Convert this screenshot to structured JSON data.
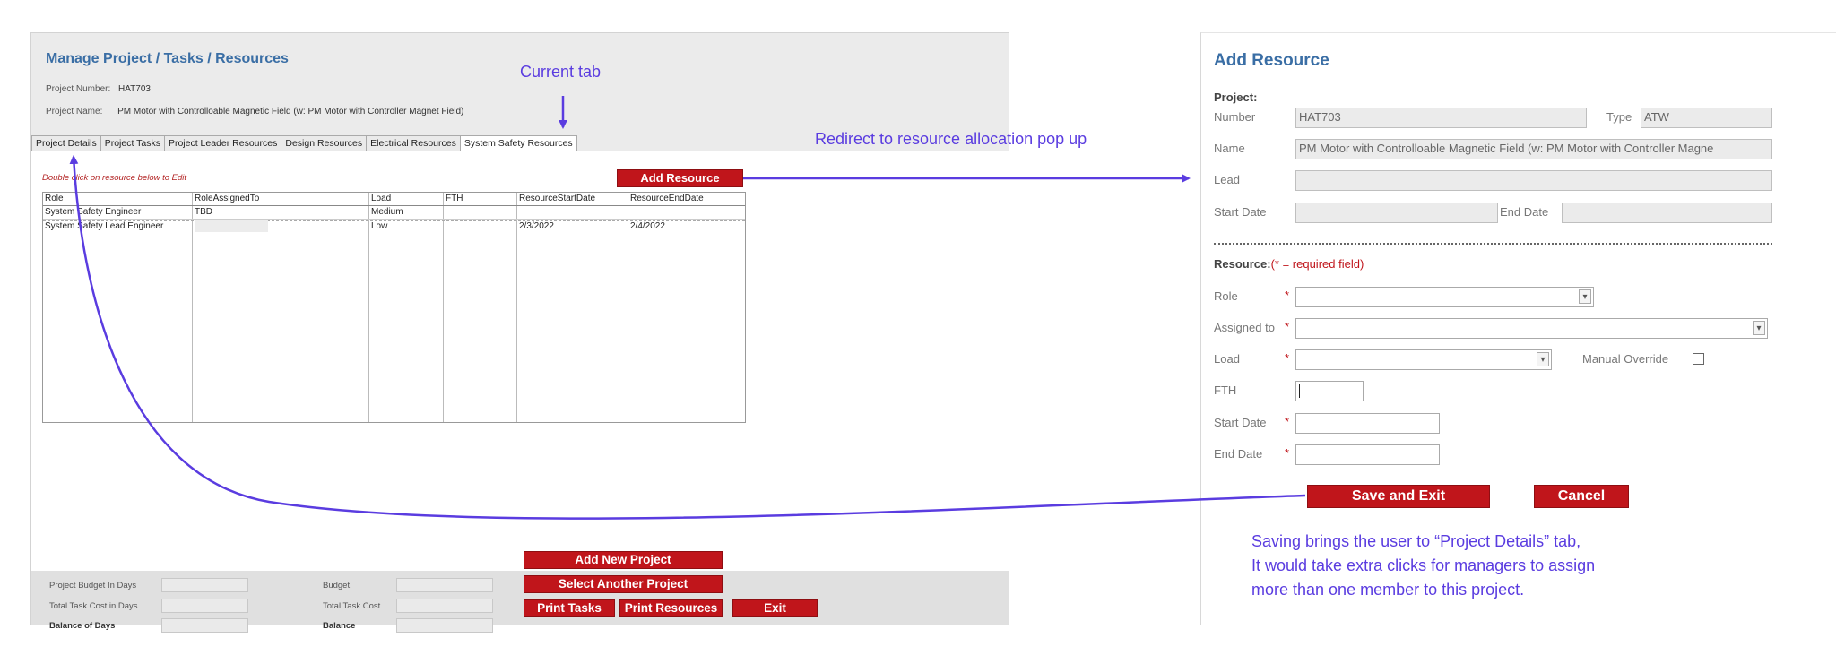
{
  "left": {
    "title": "Manage Project / Tasks / Resources",
    "project_number_label": "Project Number:",
    "project_number_value": "HAT703",
    "project_name_label": "Project Name:",
    "project_name_value": "PM Motor with Controlloable Magnetic Field (w: PM Motor with Controller Magnet Field)",
    "tabs": [
      "Project Details",
      "Project Tasks",
      "Project Leader Resources",
      "Design Resources",
      "Electrical Resources",
      "System Safety Resources"
    ],
    "active_tab": "System Safety Resources",
    "hint": "Double click on resource below to Edit",
    "add_resource_label": "Add Resource",
    "table": {
      "headers": [
        "Role",
        "RoleAssignedTo",
        "Load",
        "FTH",
        "ResourceStartDate",
        "ResourceEndDate"
      ],
      "rows": [
        [
          "System Safety Engineer",
          "TBD",
          "Medium",
          "",
          "",
          ""
        ],
        [
          "System Safety Lead Engineer",
          "",
          "Low",
          "",
          "2/3/2022",
          "2/4/2022"
        ]
      ]
    },
    "bottom": {
      "budget_days_label": "Project Budget In Days",
      "task_cost_days_label": "Total Task Cost in Days",
      "balance_days_label": "Balance of Days",
      "budget_label": "Budget",
      "task_cost_label": "Total Task Cost",
      "balance_label": "Balance",
      "add_new_project": "Add New Project",
      "select_another_project": "Select Another Project",
      "print_tasks": "Print Tasks",
      "print_resources": "Print  Resources",
      "exit": "Exit"
    }
  },
  "right": {
    "title": "Add Resource",
    "project_section": "Project:",
    "number_label": "Number",
    "number_value": "HAT703",
    "type_label": "Type",
    "type_value": "ATW",
    "name_label": "Name",
    "name_value": "PM Motor with Controlloable Magnetic Field (w: PM Motor with Controller Magne",
    "lead_label": "Lead",
    "start_date_label": "Start Date",
    "end_date_label": "End Date",
    "resource_section": "Resource:",
    "required_note": "(* = required field)",
    "role_label": "Role",
    "assigned_to_label": "Assigned to",
    "load_label": "Load",
    "manual_override_label": "Manual Override",
    "fth_label": "FTH",
    "r_start_date_label": "Start Date",
    "r_end_date_label": "End Date",
    "req_mark": "*",
    "save_exit": "Save and Exit",
    "cancel": "Cancel"
  },
  "annotations": {
    "current_tab": "Current tab",
    "redirect": "Redirect to resource allocation pop up",
    "saving_line1": "Saving brings the user to “Project Details” tab,",
    "saving_line2": "It would take extra clicks for managers to assign",
    "saving_line3": "more than one member to this project."
  },
  "colors": {
    "title_blue": "#3a6ea5",
    "button_red": "#c0151b",
    "annotation_purple": "#5a3ce0"
  },
  "icons": {
    "dropdown": "chevron-down-icon",
    "checkbox": "checkbox-icon"
  }
}
